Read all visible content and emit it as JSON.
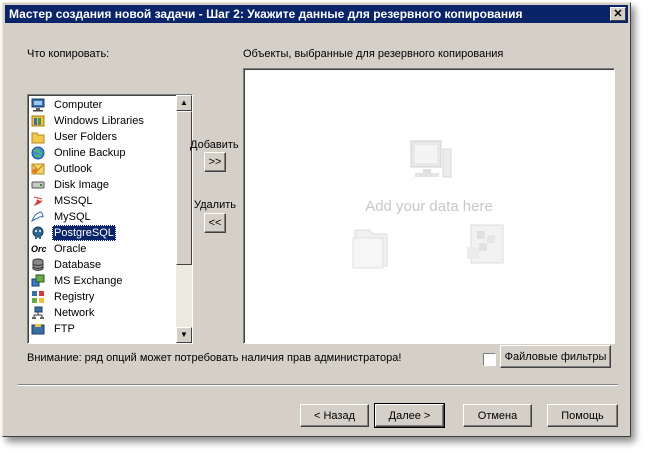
{
  "window": {
    "title": "Мастер создания новой задачи - Шаг 2: Укажите данные для резервного копирования",
    "close_glyph": "✕"
  },
  "left_label": "Что копировать:",
  "right_label": "Объекты, выбранные для резервного копирования",
  "source_list": {
    "items": [
      {
        "label": "Computer",
        "icon": "computer-icon"
      },
      {
        "label": "Windows Libraries",
        "icon": "libraries-icon"
      },
      {
        "label": "User Folders",
        "icon": "folder-icon"
      },
      {
        "label": "Online Backup",
        "icon": "globe-icon"
      },
      {
        "label": "Outlook",
        "icon": "outlook-icon"
      },
      {
        "label": "Disk Image",
        "icon": "disk-icon"
      },
      {
        "label": "MSSQL",
        "icon": "mssql-icon"
      },
      {
        "label": "MySQL",
        "icon": "mysql-icon"
      },
      {
        "label": "PostgreSQL",
        "icon": "postgresql-icon",
        "selected": true
      },
      {
        "label": "Oracle",
        "icon": "oracle-icon",
        "icon_text": "Orc"
      },
      {
        "label": "Database",
        "icon": "database-icon"
      },
      {
        "label": "MS Exchange",
        "icon": "exchange-icon"
      },
      {
        "label": "Registry",
        "icon": "registry-icon"
      },
      {
        "label": "Network",
        "icon": "network-icon"
      },
      {
        "label": "FTP",
        "icon": "ftp-icon"
      }
    ]
  },
  "actions": {
    "add_label": "Добавить",
    "add_button": ">>",
    "remove_label": "Удалить",
    "remove_button": "<<"
  },
  "drop_area": {
    "placeholder": "Add your data here"
  },
  "warning": "Внимание: ряд опций может потребовать наличия прав администратора!",
  "file_filters": {
    "label": "Файловые фильтры",
    "checked": false
  },
  "footer": {
    "back": "< Назад",
    "next": "Далее >",
    "cancel": "Отмена",
    "help": "Помощь"
  },
  "colors": {
    "title_bar": "#0a246a",
    "dialog_bg": "#d4d0c8",
    "selection": "#0a246a",
    "placeholder": "#c8c8c8"
  }
}
